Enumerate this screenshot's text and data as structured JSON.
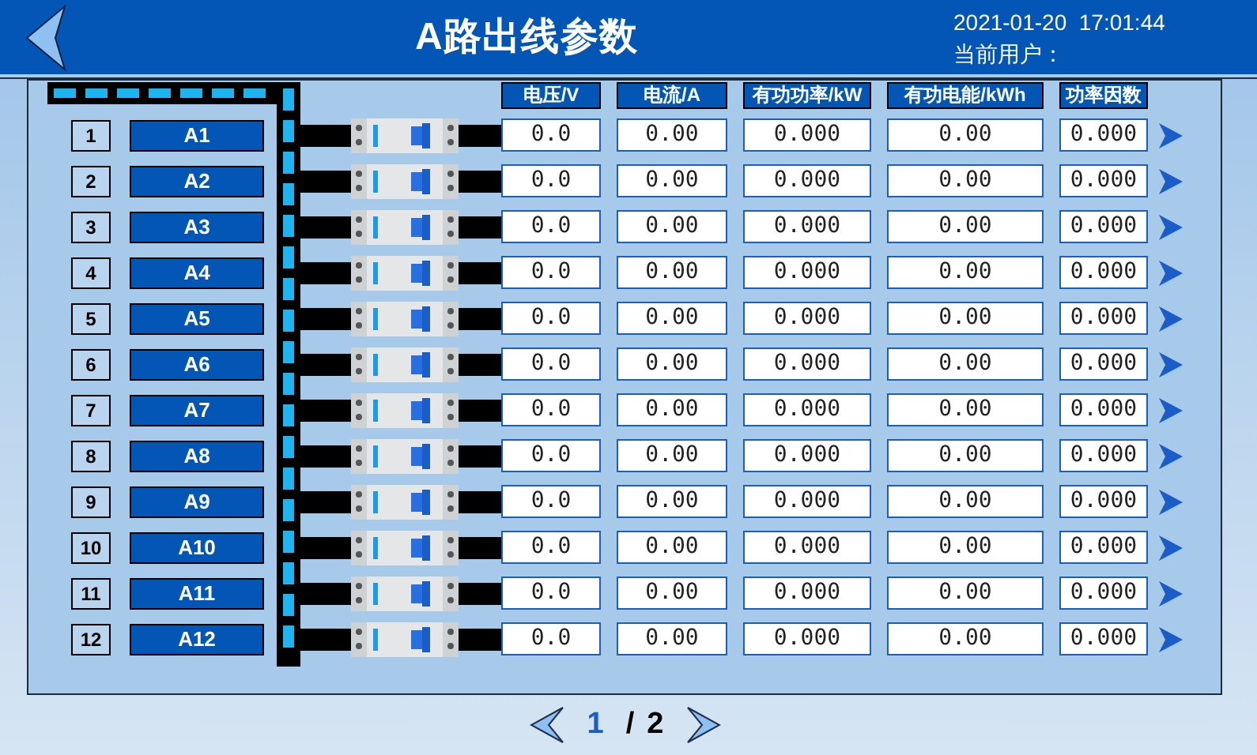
{
  "header": {
    "title": "A路出线参数",
    "datetime": "2021-01-20  17:01:44",
    "user_label": "当前用户："
  },
  "columns": [
    "电压/V",
    "电流/A",
    "有功功率/kW",
    "有功电能/kWh",
    "功率因数"
  ],
  "rows": [
    {
      "index": "1",
      "name": "A1",
      "values": [
        "0.0",
        "0.00",
        "0.000",
        "0.00",
        "0.000"
      ]
    },
    {
      "index": "2",
      "name": "A2",
      "values": [
        "0.0",
        "0.00",
        "0.000",
        "0.00",
        "0.000"
      ]
    },
    {
      "index": "3",
      "name": "A3",
      "values": [
        "0.0",
        "0.00",
        "0.000",
        "0.00",
        "0.000"
      ]
    },
    {
      "index": "4",
      "name": "A4",
      "values": [
        "0.0",
        "0.00",
        "0.000",
        "0.00",
        "0.000"
      ]
    },
    {
      "index": "5",
      "name": "A5",
      "values": [
        "0.0",
        "0.00",
        "0.000",
        "0.00",
        "0.000"
      ]
    },
    {
      "index": "6",
      "name": "A6",
      "values": [
        "0.0",
        "0.00",
        "0.000",
        "0.00",
        "0.000"
      ]
    },
    {
      "index": "7",
      "name": "A7",
      "values": [
        "0.0",
        "0.00",
        "0.000",
        "0.00",
        "0.000"
      ]
    },
    {
      "index": "8",
      "name": "A8",
      "values": [
        "0.0",
        "0.00",
        "0.000",
        "0.00",
        "0.000"
      ]
    },
    {
      "index": "9",
      "name": "A9",
      "values": [
        "0.0",
        "0.00",
        "0.000",
        "0.00",
        "0.000"
      ]
    },
    {
      "index": "10",
      "name": "A10",
      "values": [
        "0.0",
        "0.00",
        "0.000",
        "0.00",
        "0.000"
      ]
    },
    {
      "index": "11",
      "name": "A11",
      "values": [
        "0.0",
        "0.00",
        "0.000",
        "0.00",
        "0.000"
      ]
    },
    {
      "index": "12",
      "name": "A12",
      "values": [
        "0.0",
        "0.00",
        "0.000",
        "0.00",
        "0.000"
      ]
    }
  ],
  "pagination": {
    "current": "1",
    "separator": "/",
    "total": "2"
  }
}
